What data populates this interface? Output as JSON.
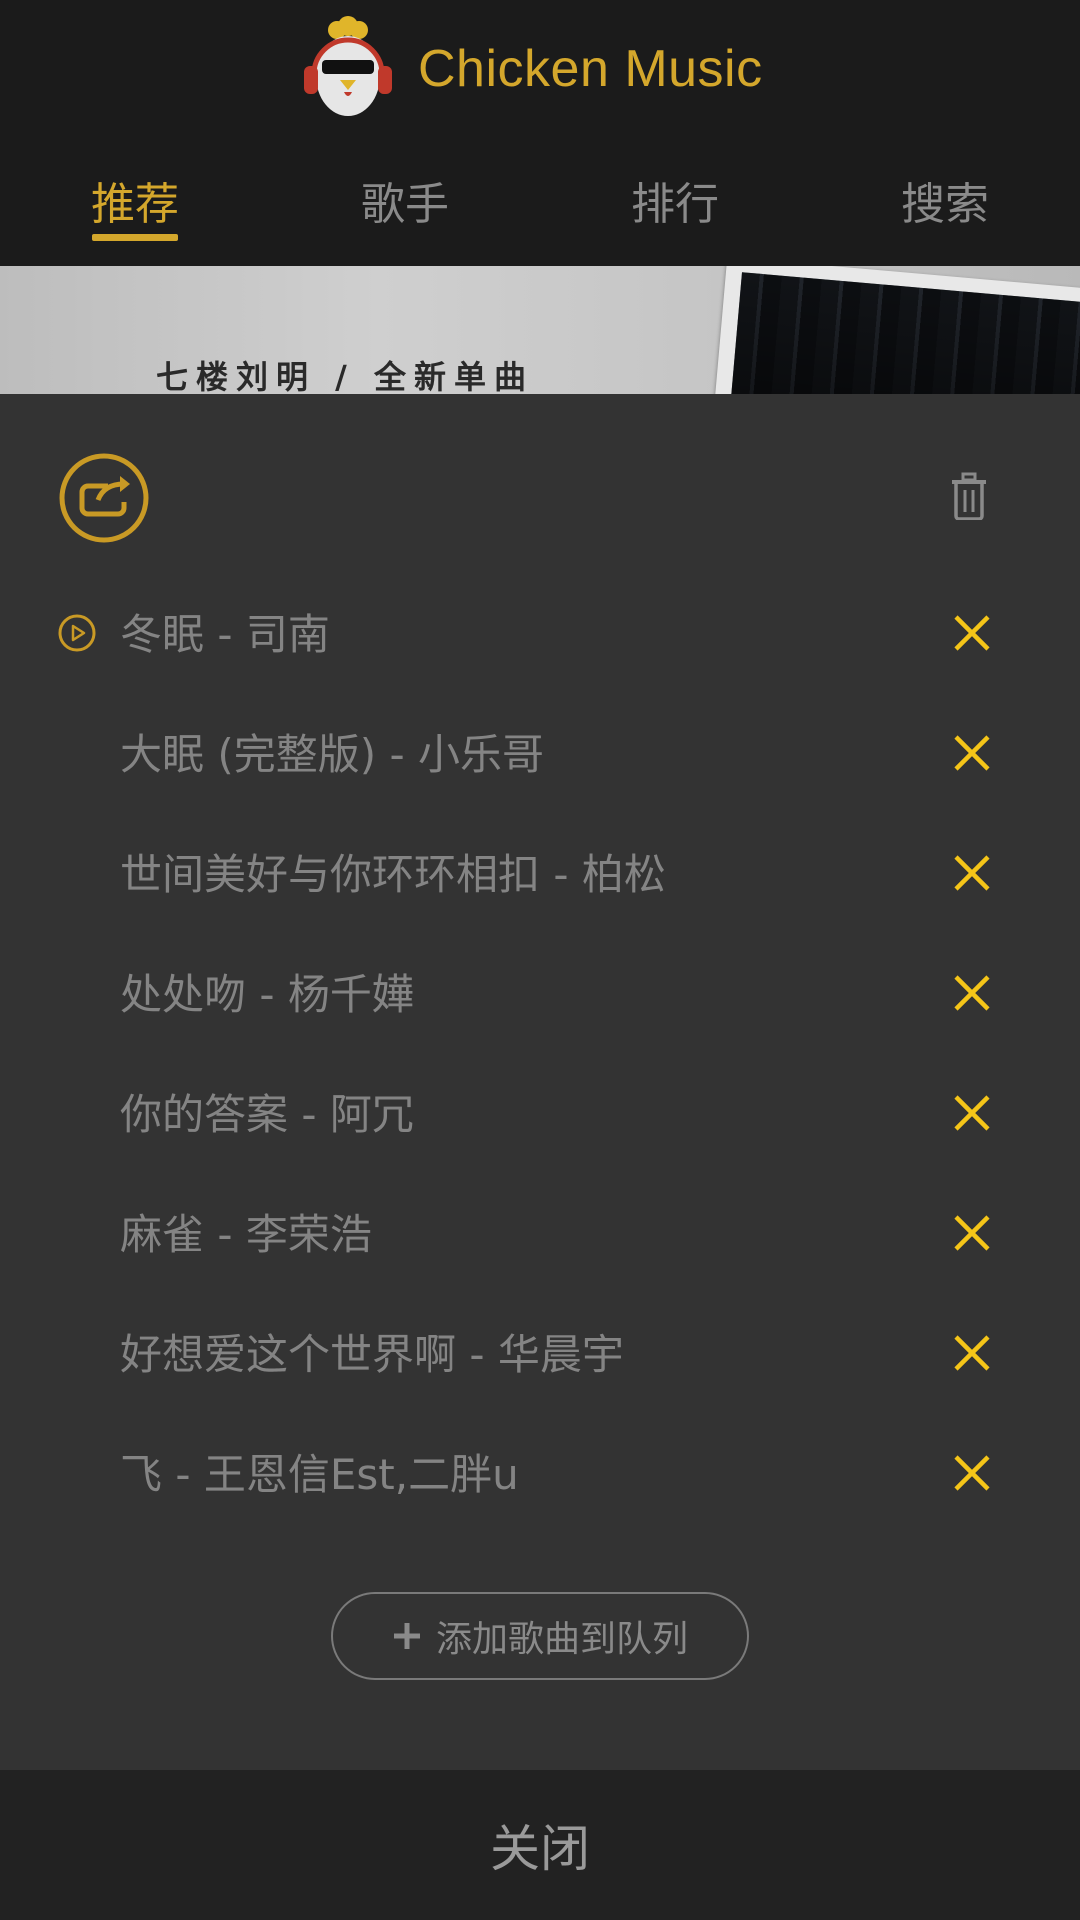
{
  "app": {
    "title": "Chicken Music"
  },
  "tabs": [
    {
      "label": "推荐",
      "active": true
    },
    {
      "label": "歌手",
      "active": false
    },
    {
      "label": "排行",
      "active": false
    },
    {
      "label": "搜索",
      "active": false
    }
  ],
  "banner": {
    "caption": "七楼刘明 / 全新单曲"
  },
  "playlist": {
    "mode_icon": "loop-icon",
    "clear_icon": "trash-icon",
    "songs": [
      {
        "label": "冬眠 - 司南",
        "playing": true
      },
      {
        "label": "大眠 (完整版) - 小乐哥",
        "playing": false
      },
      {
        "label": "世间美好与你环环相扣 - 柏松",
        "playing": false
      },
      {
        "label": "处处吻 - 杨千嬅",
        "playing": false
      },
      {
        "label": "你的答案 - 阿冗",
        "playing": false
      },
      {
        "label": "麻雀 - 李荣浩",
        "playing": false
      },
      {
        "label": "好想爱这个世界啊 - 华晨宇",
        "playing": false
      },
      {
        "label": "飞 - 王恩信Est,二胖u",
        "playing": false
      }
    ],
    "add_label": "添加歌曲到队列",
    "close_label": "关闭"
  },
  "colors": {
    "accent": "#d4a72c",
    "delete": "#f5c518",
    "panel": "#333333"
  }
}
